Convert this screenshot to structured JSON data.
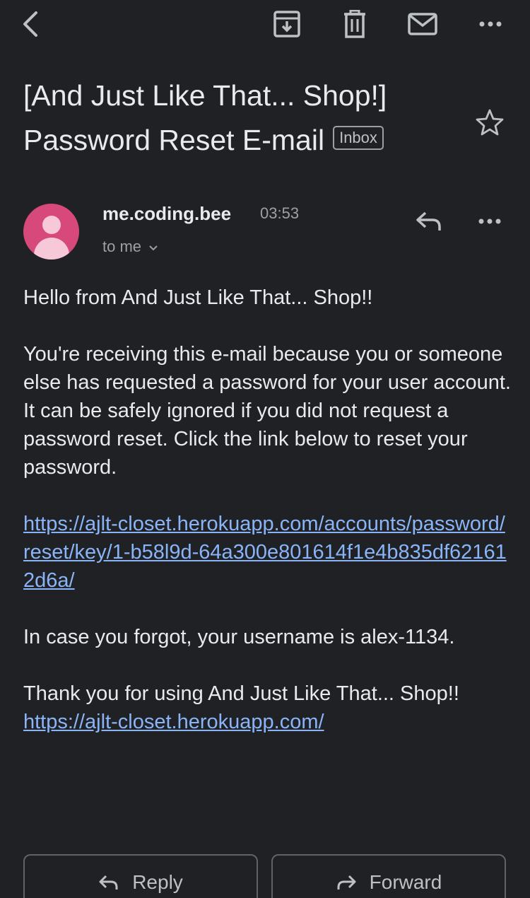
{
  "toolbar": {
    "icons": [
      "back-icon",
      "archive-icon",
      "delete-icon",
      "mark-unread-icon",
      "more-icon"
    ]
  },
  "email": {
    "subject_line1": "[And Just Like That... Shop!]",
    "subject_line2": "Password Reset E-mail",
    "label": "Inbox",
    "sender": "me.coding.bee",
    "time": "03:53",
    "recipient": "to me",
    "greeting": "Hello from And Just Like That... Shop!!",
    "paragraph1_line1": "You're receiving this e-mail because you or someone else has requested a password for your user account.",
    "paragraph1_line2": "It can be safely ignored if you did not request a password reset. Click the link below to reset your password.",
    "reset_link": "https://ajlt-closet.herokuapp.com/accounts/password/reset/key/1-b58l9d-64a300e801614f1e4b835df621612d6a/",
    "username_note": "In case you forgot, your username is alex-1134.",
    "thanks": "Thank you for using And Just Like That... Shop!!",
    "site_link": "https://ajlt-closet.herokuapp.com/"
  },
  "actions": {
    "reply_label": "Reply",
    "forward_label": "Forward"
  },
  "colors": {
    "background": "#202124",
    "avatar": "#d6497a",
    "link": "#8ab4f8"
  }
}
